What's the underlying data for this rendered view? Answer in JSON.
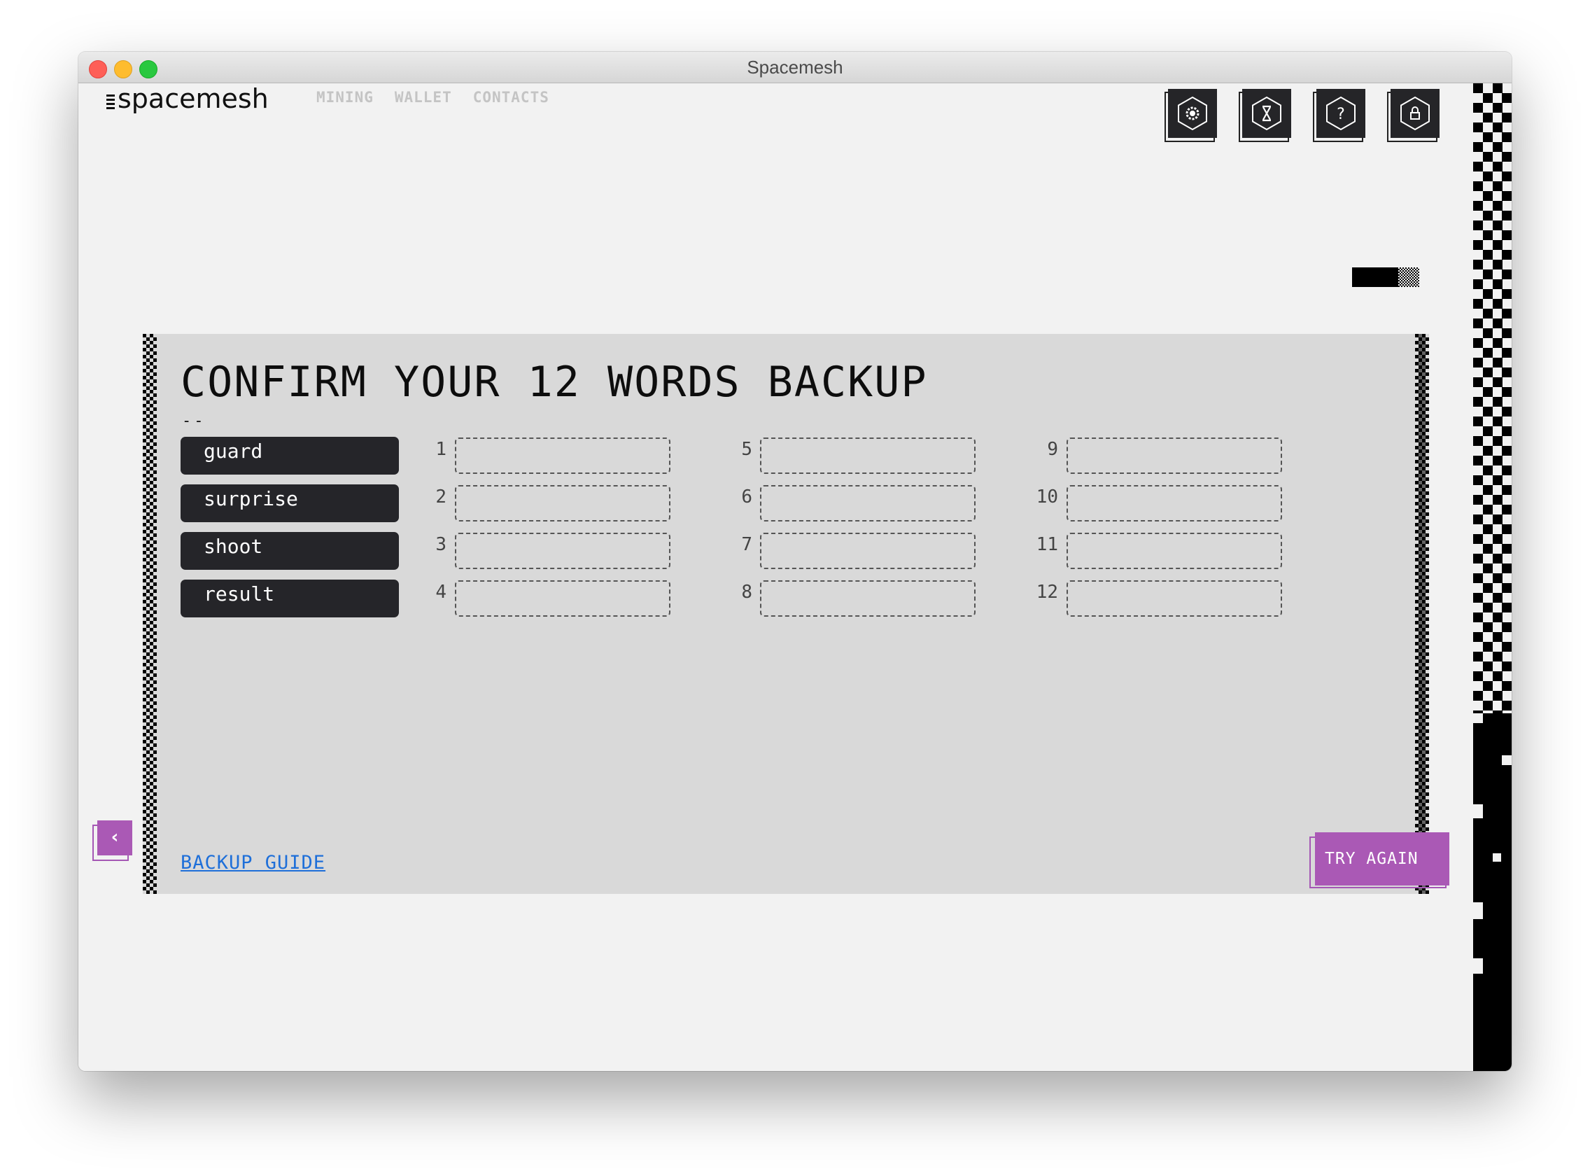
{
  "window": {
    "title": "Spacemesh"
  },
  "header": {
    "logo": "spacemesh",
    "nav": [
      "MINING",
      "WALLET",
      "CONTACTS"
    ],
    "icons": [
      "settings-icon",
      "hourglass-icon",
      "help-icon",
      "lock-icon"
    ]
  },
  "backup": {
    "title": "CONFIRM YOUR 12 WORDS BACKUP",
    "title_underline": "--",
    "words": [
      "guard",
      "surprise",
      "shoot",
      "result"
    ],
    "slots": [
      "1",
      "2",
      "3",
      "4",
      "5",
      "6",
      "7",
      "8",
      "9",
      "10",
      "11",
      "12"
    ],
    "guide_link": "BACKUP GUIDE",
    "try_again": "TRY AGAIN",
    "back_icon": "chevron-left-icon"
  },
  "colors": {
    "accent": "#aa59b5",
    "word_chip": "#252529",
    "panel": "#d9d9d9",
    "link": "#1e6fd9"
  }
}
